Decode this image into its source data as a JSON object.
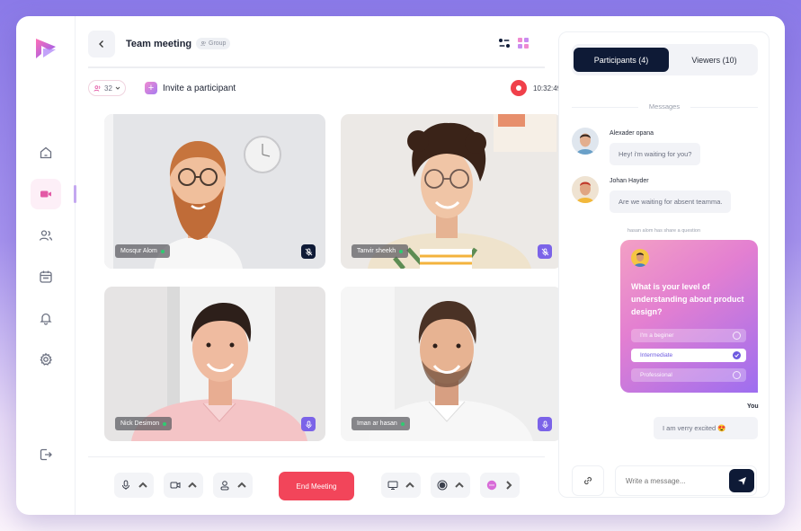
{
  "header": {
    "title": "Team meeting",
    "group_label": "Group"
  },
  "toolbar": {
    "participant_count": "32",
    "invite_label": "Invite  a participant",
    "recording_time": "10:32:49"
  },
  "tiles": [
    {
      "name": "Mosqur Alom",
      "mic": "muted"
    },
    {
      "name": "Tanvir sheekh",
      "mic": "muted"
    },
    {
      "name": "Nick Desimon",
      "mic": "on"
    },
    {
      "name": "Iman ar hasan",
      "mic": "on"
    }
  ],
  "controls": {
    "end_meeting_label": "End Meeting"
  },
  "panel": {
    "tabs": [
      {
        "label": "Participants (4)",
        "active": true
      },
      {
        "label": "Viewers (10)",
        "active": false
      }
    ],
    "messages_label": "Messages",
    "messages": [
      {
        "author": "Alexader opana",
        "text": "Hey! i'm waiting for you?"
      },
      {
        "author": "Johan Hayder",
        "text": "Are we waiting for absent teamma."
      }
    ],
    "share_note": "hasan alom has share a question",
    "poll": {
      "question": "What is your level of understanding about product design?",
      "options": [
        {
          "label": "I'm a beginer",
          "selected": false
        },
        {
          "label": "Intermediate",
          "selected": true
        },
        {
          "label": "Professional",
          "selected": false
        }
      ]
    },
    "you_label": "You",
    "you_message": "I am verry excited 😍",
    "input_placeholder": "Write a message..."
  },
  "colors": {
    "accent_dark": "#0e1a36",
    "end_red": "#f2455a",
    "record_red": "#f0404a",
    "poll_purple": "#6d5ae0"
  }
}
